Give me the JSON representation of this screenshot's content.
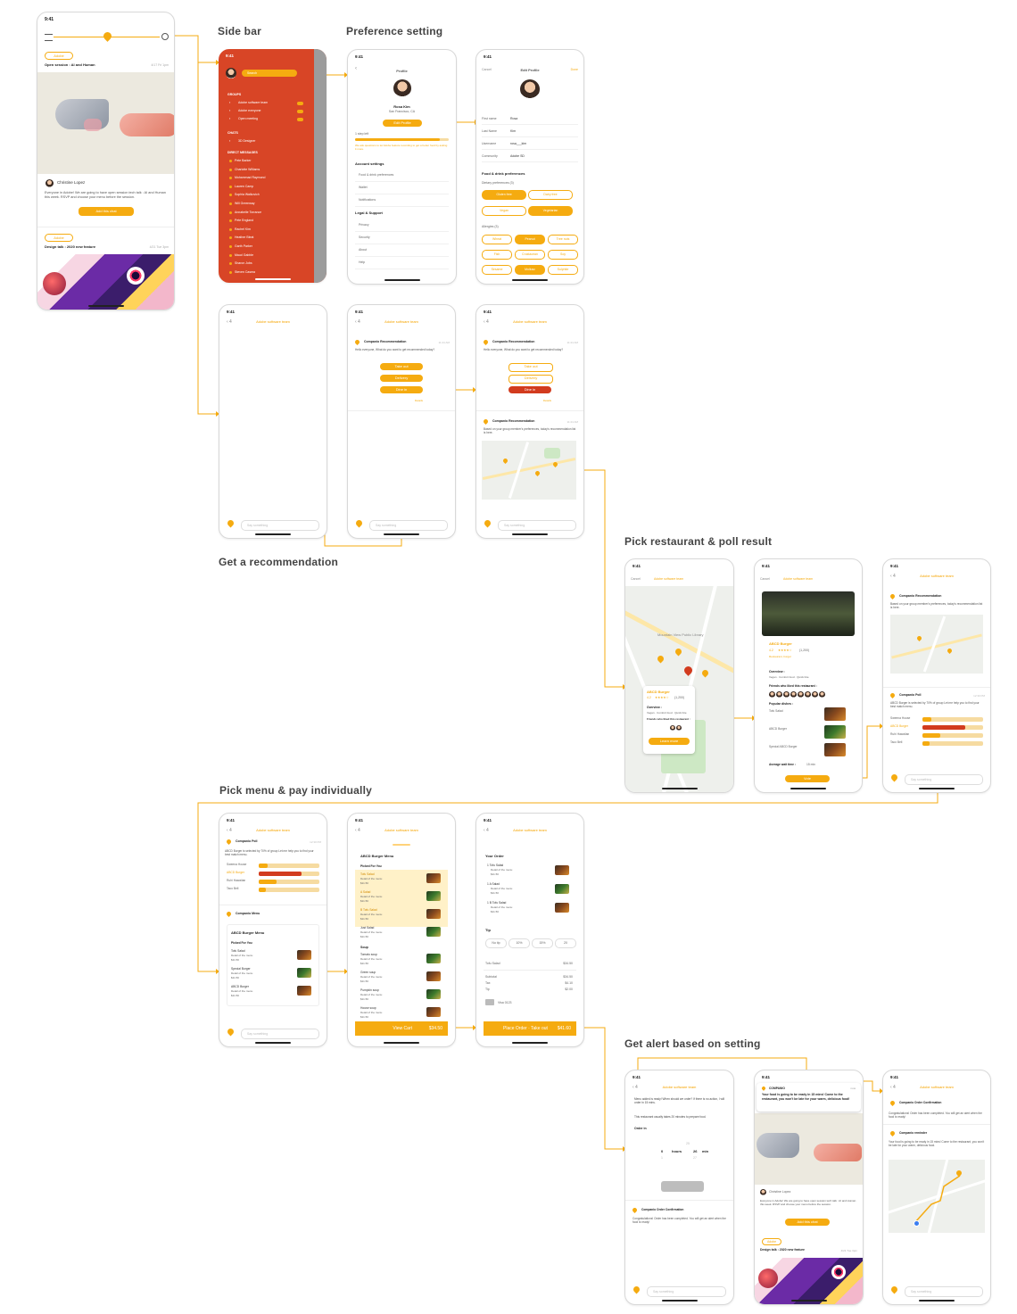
{
  "sections": {
    "side_bar": "Side bar",
    "preference_setting": "Preference setting",
    "get_recommendation": "Get a recommendation",
    "pick_restaurant": "Pick restaurant & poll result",
    "pick_menu": "Pick menu & pay individually",
    "get_alert": "Get alert based on setting"
  },
  "status_time": "9:41",
  "home": {
    "tag1": "Adobe",
    "session_title": "Open session : AI and Human",
    "session_date": "4/17 Fri 1pm",
    "host_name": "Christine Lopez",
    "description": "Everyone in Adobe! We are going to have open session tech talk : AI and Human this week. RSVP and choose your menu before the session.",
    "add_button": "Add this chat",
    "tag2": "Adobe",
    "talk_title": "Design talk : 2020 new feature",
    "talk_date": "4/21 Tue 3pm"
  },
  "sidebar": {
    "search_placeholder": "Search",
    "groups_header": "GROUPS",
    "groups": [
      "Adobe software team",
      "Adobe everyone",
      "Open meeting"
    ],
    "chats_header": "CHATS",
    "chats": [
      "3D Designer"
    ],
    "dm_header": "DIRECT MESSAGES",
    "dms": [
      "Pete Barker",
      "Charlotte Williams",
      "Mohammad Raymond",
      "Lauren Camp",
      "Sophia Walkovich",
      "Will Greenway",
      "Annabelle Torrance",
      "Pete England",
      "Rachel Kim",
      "Heather Bleat",
      "Garth Parker",
      "Maud Gabble",
      "Sharon Jobs",
      "Steven Casma"
    ]
  },
  "profile": {
    "title": "Profile",
    "name": "Rosa Kim",
    "location": "San Francisco, CA",
    "edit_button": "Edit Profile",
    "steps_left": "1 step left",
    "steps_hint": "We ask questions to let Adobe feature recording to get a better food by asking it more.",
    "account_header": "Account settings",
    "account_items": [
      "Food & drink preferences",
      "Wallet",
      "Notifications"
    ],
    "legal_header": "Legal & Support",
    "legal_items": [
      "Privacy",
      "Security",
      "About",
      "Help"
    ]
  },
  "edit_profile": {
    "cancel": "Cancel",
    "title": "Edit Profile",
    "done": "Done",
    "fields": [
      {
        "label": "First name",
        "value": "Rosa"
      },
      {
        "label": "Last Name",
        "value": "Kim"
      },
      {
        "label": "Username",
        "value": "rosa___kim"
      },
      {
        "label": "Community",
        "value": "Adobe SD"
      }
    ],
    "food_header": "Food & drink preferences",
    "dietary_label": "Dietary preferences (3)",
    "dietary": [
      "Gluten free",
      "Dairy free",
      "Vegan",
      "Vegetarian"
    ],
    "allergies_label": "Allergies (3)",
    "allergies": [
      "Wheat",
      "Peanut",
      "Tree nuts",
      "Fish",
      "Crustacean",
      "Soy",
      "Sesame",
      "Mollusc",
      "Sulphite"
    ]
  },
  "chat": {
    "team": "Adobe software team",
    "compose_placeholder": "Say something",
    "rec_sender": "Companio Recommendation",
    "rec_time": "11:24 AM",
    "rec_question": "Hello everyone, What do you want to get recommended today?",
    "options": [
      "Take out",
      "Delivery",
      "Dine in"
    ],
    "options_link": "Details",
    "result_text": "Based on your group member's preferences, today's recommendation list is here."
  },
  "restaurant": {
    "cancel": "Cancel",
    "name": "ABCD Burger",
    "rating": "4.2",
    "reviews": "(1,200)",
    "tags": "Restaurant, burger",
    "overview_label": "Overview :",
    "overview_text": "Vegan · Comfort food · Quick bite",
    "friends_label": "Friends who liked this restaurant :",
    "popular_label": "Popular dishes :",
    "popular": [
      "Tofu Salad",
      "ABCD Burger",
      "Special ABCD Burger"
    ],
    "avg_wait_label": "Average wait time :",
    "avg_wait_value": "15 min",
    "learn_more": "Learn more",
    "vote": "Vote",
    "map_label": "Mountain View Public Library"
  },
  "poll": {
    "sender": "Companio Poll",
    "time": "12:30 PM",
    "text": "ABCD Burger is selected by 70% of group Let me help you to find your best match menu.",
    "rows": [
      {
        "label": "Sweena House",
        "value": 0.15
      },
      {
        "label": "ABCD Burger",
        "value": 0.7
      },
      {
        "label": "Ruhi Hawaiian",
        "value": 0.3
      },
      {
        "label": "Taco Bell",
        "value": 0.12
      }
    ]
  },
  "menu": {
    "sender": "Companio Menu",
    "title": "ABCD Burger Menu",
    "picked_label": "Picked For You",
    "items": [
      {
        "name": "Tofu Salad",
        "desc": "Detail of the menu",
        "price": "$11.50"
      },
      {
        "name": "A Salad",
        "desc": "Detail of the menu",
        "price": "$11.50"
      },
      {
        "name": "B Tofu Salad",
        "desc": "Detail of the menu",
        "price": "$11.50"
      },
      {
        "name": "Just Salad",
        "desc": "Detail of the menu",
        "price": "$11.50"
      }
    ],
    "soup_label": "Soup",
    "soups": [
      {
        "name": "Tomato soup",
        "desc": "Detail of the menu",
        "price": "$11.50"
      },
      {
        "name": "Green soup",
        "desc": "Detail of the menu",
        "price": "$11.50"
      },
      {
        "name": "Pumpkin soup",
        "desc": "Detail of the menu",
        "price": "$11.50"
      },
      {
        "name": "House soup",
        "desc": "Detail of the menu",
        "price": "$11.50"
      }
    ],
    "view_cart": "View Cart",
    "cart_total": "$34.50"
  },
  "order": {
    "your_order": "Your Order",
    "items": [
      {
        "name": "1 Tofu Salad",
        "desc": "Detail of the menu",
        "price": "$11.50"
      },
      {
        "name": "1 A Salad",
        "desc": "Detail of the menu",
        "price": "$11.50"
      },
      {
        "name": "1 B Tofu Salad",
        "desc": "Detail of the menu",
        "price": "$11.50"
      }
    ],
    "tip_label": "Tip",
    "tips": [
      "No tip",
      "10%",
      "15%",
      "20"
    ],
    "subtotal_label": "Subtotal",
    "subtotal": "$34.50",
    "tax_label": "Tax",
    "tax": "$4.10",
    "tip_row": "Tip",
    "tip_value": "$2.00",
    "card": "Visa 0123",
    "place_order": "Place Order · Take out",
    "order_total": "$41.60"
  },
  "alert": {
    "question": "Menu added is ready! When should we order? If there is no action, I will order in 15 mins.",
    "note": "This restaurant usually takes 20 minutes to prepare food.",
    "order_in": "Order in",
    "hours_label": "hours",
    "min_label": "min",
    "hours_value": "0",
    "min_value": "26",
    "confirm_sender": "Companio Order Confirmation",
    "confirm_text": "Congratulations! Order has been completed. You will get an alert when the food is ready!",
    "notif_app": "COMPANIO",
    "notif_time": "now",
    "notif_text": "Your food is going to be ready in 15 mins! Come to the restaurant, you won't be late for your warm, delicious food!",
    "reminder_sender": "Companio reminder",
    "reminder_text": "Your food is going to be ready in 15 mins! Come to the restaurant, you won't be late for your warm, delicious food."
  },
  "colors": {
    "accent": "#f5ab10",
    "red": "#d23b1e",
    "sidebar": "#d84526"
  }
}
